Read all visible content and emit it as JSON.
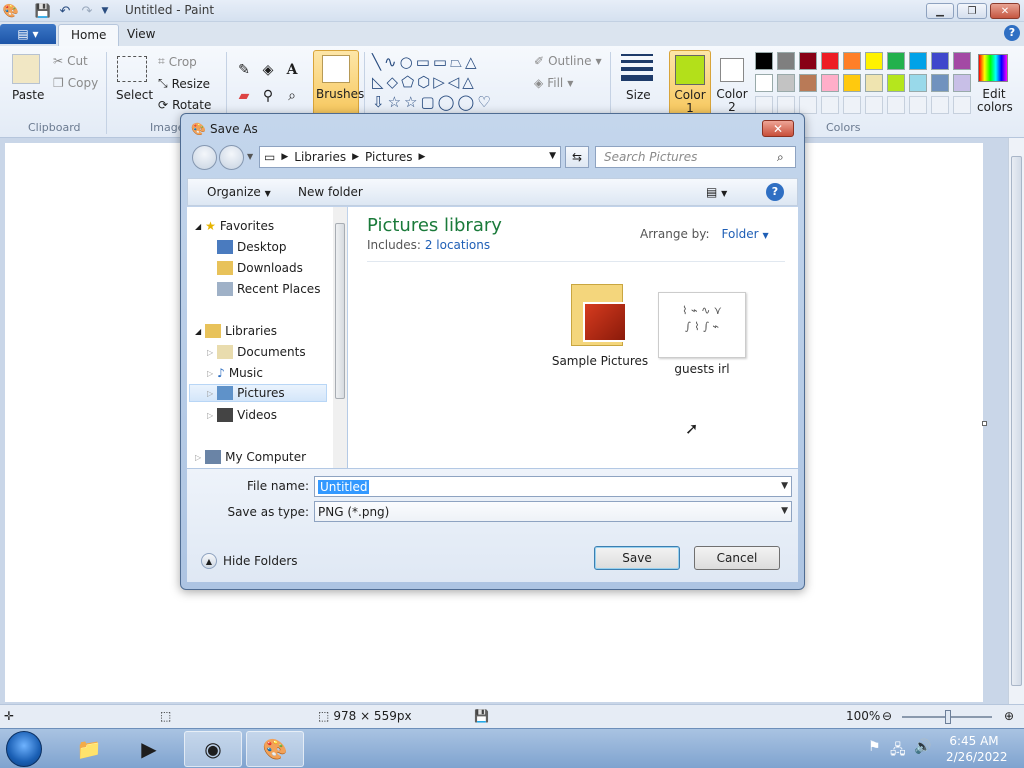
{
  "window": {
    "title": "Untitled - Paint",
    "minimize": "▁",
    "maximize": "❐",
    "close": "✕"
  },
  "tabs": {
    "file_icon": "paint-menu-icon",
    "home": "Home",
    "view": "View",
    "help": "?"
  },
  "ribbon": {
    "clipboard": {
      "paste": "Paste",
      "cut": "Cut",
      "copy": "Copy",
      "group": "Clipboard"
    },
    "image": {
      "select": "Select",
      "crop": "Crop",
      "resize": "Resize",
      "rotate": "Rotate",
      "group": "Image"
    },
    "brushes": "Brushes",
    "shapes": {
      "outline": "Outline",
      "fill": "Fill"
    },
    "size": "Size",
    "color1": "Color 1",
    "color2": "Color 2",
    "edit_colors": "Edit colors",
    "colors_group": "Colors",
    "color1_value": "#b3e01a",
    "palette": [
      "#000000",
      "#7f7f7f",
      "#880015",
      "#ed1c24",
      "#ff7f27",
      "#fff200",
      "#22b14c",
      "#00a2e8",
      "#3f48cc",
      "#a349a4",
      "#ffffff",
      "#c3c3c3",
      "#b97a57",
      "#ffaec9",
      "#ffc90e",
      "#efe4b0",
      "#b5e61d",
      "#99d9ea",
      "#7092be",
      "#c8bfe7"
    ]
  },
  "dialog": {
    "title": "Save As",
    "address": {
      "root": "Libraries",
      "folder": "Pictures"
    },
    "search_placeholder": "Search Pictures",
    "organize": "Organize",
    "new_folder": "New folder",
    "nav": {
      "favorites": "Favorites",
      "desktop": "Desktop",
      "downloads": "Downloads",
      "recent": "Recent Places",
      "libraries": "Libraries",
      "documents": "Documents",
      "music": "Music",
      "pictures": "Pictures",
      "videos": "Videos",
      "computer": "My Computer"
    },
    "library_title": "Pictures library",
    "includes_label": "Includes:",
    "includes_link": "2 locations",
    "arrange_label": "Arrange by:",
    "arrange_value": "Folder",
    "items": [
      {
        "name": "Sample Pictures",
        "icon": "folder-icon"
      },
      {
        "name": "guests irl",
        "icon": "image-thumbnail"
      }
    ],
    "file_name_label": "File name:",
    "file_name_value": "Untitled",
    "save_type_label": "Save as type:",
    "save_type_value": "PNG (*.png)",
    "save": "Save",
    "cancel": "Cancel",
    "hide_folders": "Hide Folders"
  },
  "status": {
    "dimensions": "978 × 559px",
    "zoom": "100%"
  },
  "taskbar": {
    "time": "6:45 AM",
    "date": "2/26/2022"
  }
}
